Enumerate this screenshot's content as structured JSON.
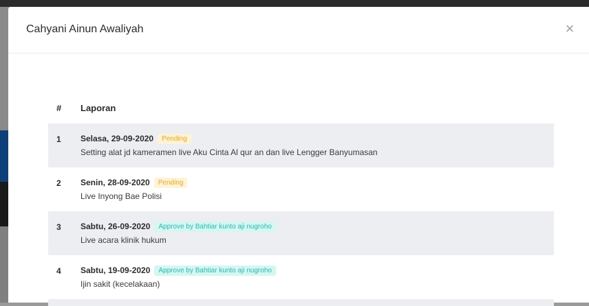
{
  "modal": {
    "title": "Cahyani Ainun Awaliyah",
    "close_icon": "×"
  },
  "table": {
    "headers": {
      "num": "#",
      "laporan": "Laporan"
    },
    "rows": [
      {
        "num": "1",
        "date": "Selasa, 29-09-2020",
        "status": "Pending",
        "status_type": "pending",
        "desc": "Setting alat jd kameramen live Aku Cinta Al qur an dan live Lengger Banyumasan"
      },
      {
        "num": "2",
        "date": "Senin, 28-09-2020",
        "status": "Pending",
        "status_type": "pending",
        "desc": "Live Inyong Bae Polisi"
      },
      {
        "num": "3",
        "date": "Sabtu, 26-09-2020",
        "status": "Approve by Bahtiar kunto aji nugroho",
        "status_type": "approved",
        "desc": "Live acara klinik hukum"
      },
      {
        "num": "4",
        "date": "Sabtu, 19-09-2020",
        "status": "Approve by Bahtiar kunto aji nugroho",
        "status_type": "approved",
        "desc": "Ijin sakit (kecelakaan)"
      }
    ]
  },
  "colors": {
    "pending_bg": "#fff3d6",
    "pending_text": "#f5a623",
    "approved_bg": "#d6f6f2",
    "approved_text": "#1fbfb0",
    "stripe": "#eceef1"
  }
}
